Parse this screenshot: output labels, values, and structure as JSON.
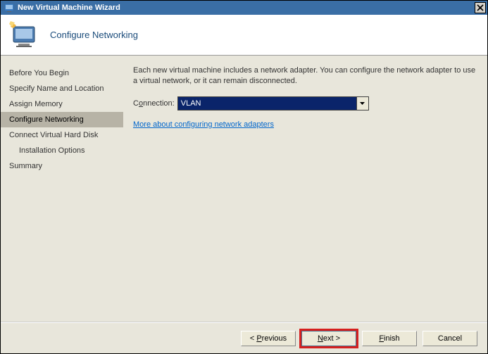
{
  "window": {
    "title": "New Virtual Machine Wizard"
  },
  "header": {
    "title": "Configure Networking"
  },
  "sidebar": {
    "items": [
      {
        "label": "Before You Begin"
      },
      {
        "label": "Specify Name and Location"
      },
      {
        "label": "Assign Memory"
      },
      {
        "label": "Configure Networking"
      },
      {
        "label": "Connect Virtual Hard Disk"
      },
      {
        "label": "Installation Options"
      },
      {
        "label": "Summary"
      }
    ]
  },
  "content": {
    "description": "Each new virtual machine includes a network adapter. You can configure the network adapter to use a virtual network, or it can remain disconnected.",
    "conn_label": "Connection:",
    "conn_value": "VLAN",
    "more_link": "More about configuring network adapters"
  },
  "footer": {
    "previous": "< Previous",
    "next": "Next >",
    "finish": "Finish",
    "cancel": "Cancel"
  }
}
